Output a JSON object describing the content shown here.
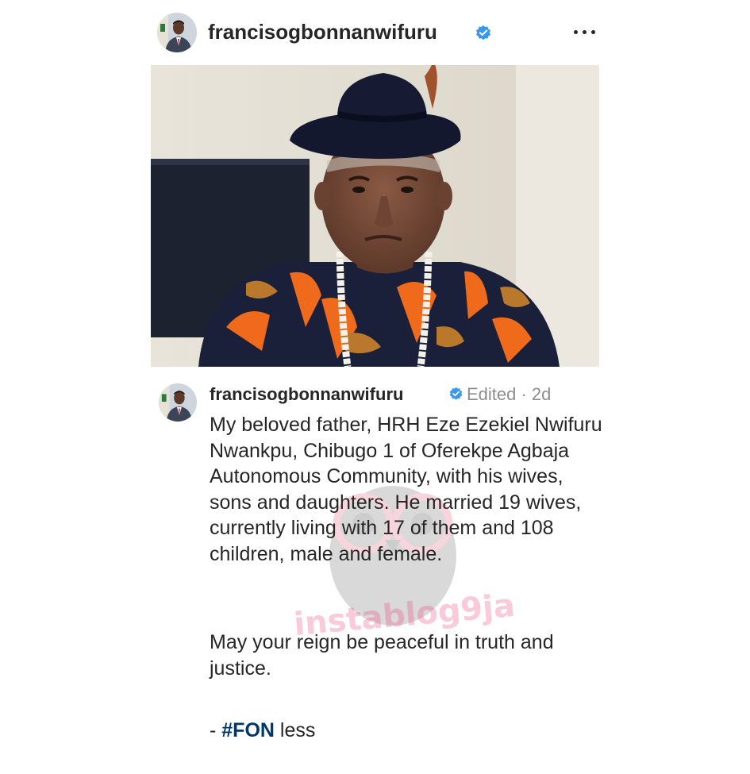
{
  "post": {
    "username": "francisogbonnanwifuru",
    "more_icon": "more-horizontal-icon",
    "verified_icon": "verified-badge-icon"
  },
  "caption": {
    "username": "francisogbonnanwifuru",
    "meta": "Edited · 2d",
    "body": "My beloved father, HRH Eze Ezekiel Nwifuru Nwankpu, Chibugo 1 of Oferekpe Agbaja Autonomous Community, with his wives, sons and daughters. He married 19 wives, currently living with 17 of them and 108 children, male and female.",
    "closing": "May your reign be peaceful in truth and justice.",
    "signoff_prefix": "- ",
    "hashtag": "#FON",
    "signoff_suffix": " less"
  },
  "watermark": "instablog9ja",
  "colors": {
    "verified": "#3897f0",
    "hashtag": "#00376b",
    "meta": "#8e8e8e",
    "watermark": "#ec407a"
  }
}
